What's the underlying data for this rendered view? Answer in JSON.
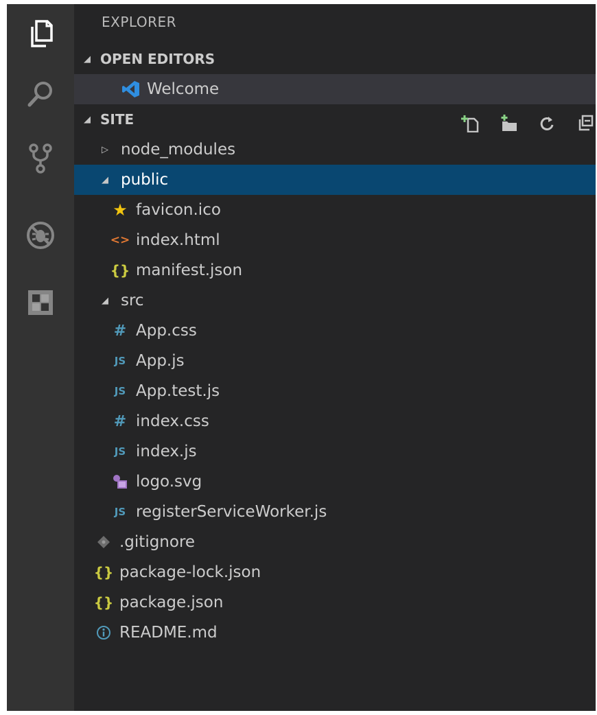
{
  "explorer": {
    "title": "EXPLORER"
  },
  "open_editors": {
    "header": "OPEN EDITORS",
    "items": [
      {
        "label": "Welcome"
      }
    ]
  },
  "folder": {
    "name": "SITE"
  },
  "tree": {
    "node_modules": "node_modules",
    "public": "public",
    "public_files": [
      "favicon.ico",
      "index.html",
      "manifest.json"
    ],
    "src": "src",
    "src_files": [
      "App.css",
      "App.js",
      "App.test.js",
      "index.css",
      "index.js",
      "logo.svg",
      "registerServiceWorker.js"
    ],
    "root_files": [
      ".gitignore",
      "package-lock.json",
      "package.json",
      "README.md"
    ]
  },
  "icons": {
    "js_glyph": "JS",
    "css_glyph": "#",
    "json_glyph": "{}",
    "html_glyph": "<>",
    "info_glyph": "i"
  },
  "colors": {
    "selection": "#094771",
    "activity_bar": "#333333",
    "sidebar": "#252526",
    "js": "#519aba",
    "json": "#cbcb41",
    "html": "#e37933",
    "svg": "#a074c4",
    "star": "#f1c40f"
  }
}
